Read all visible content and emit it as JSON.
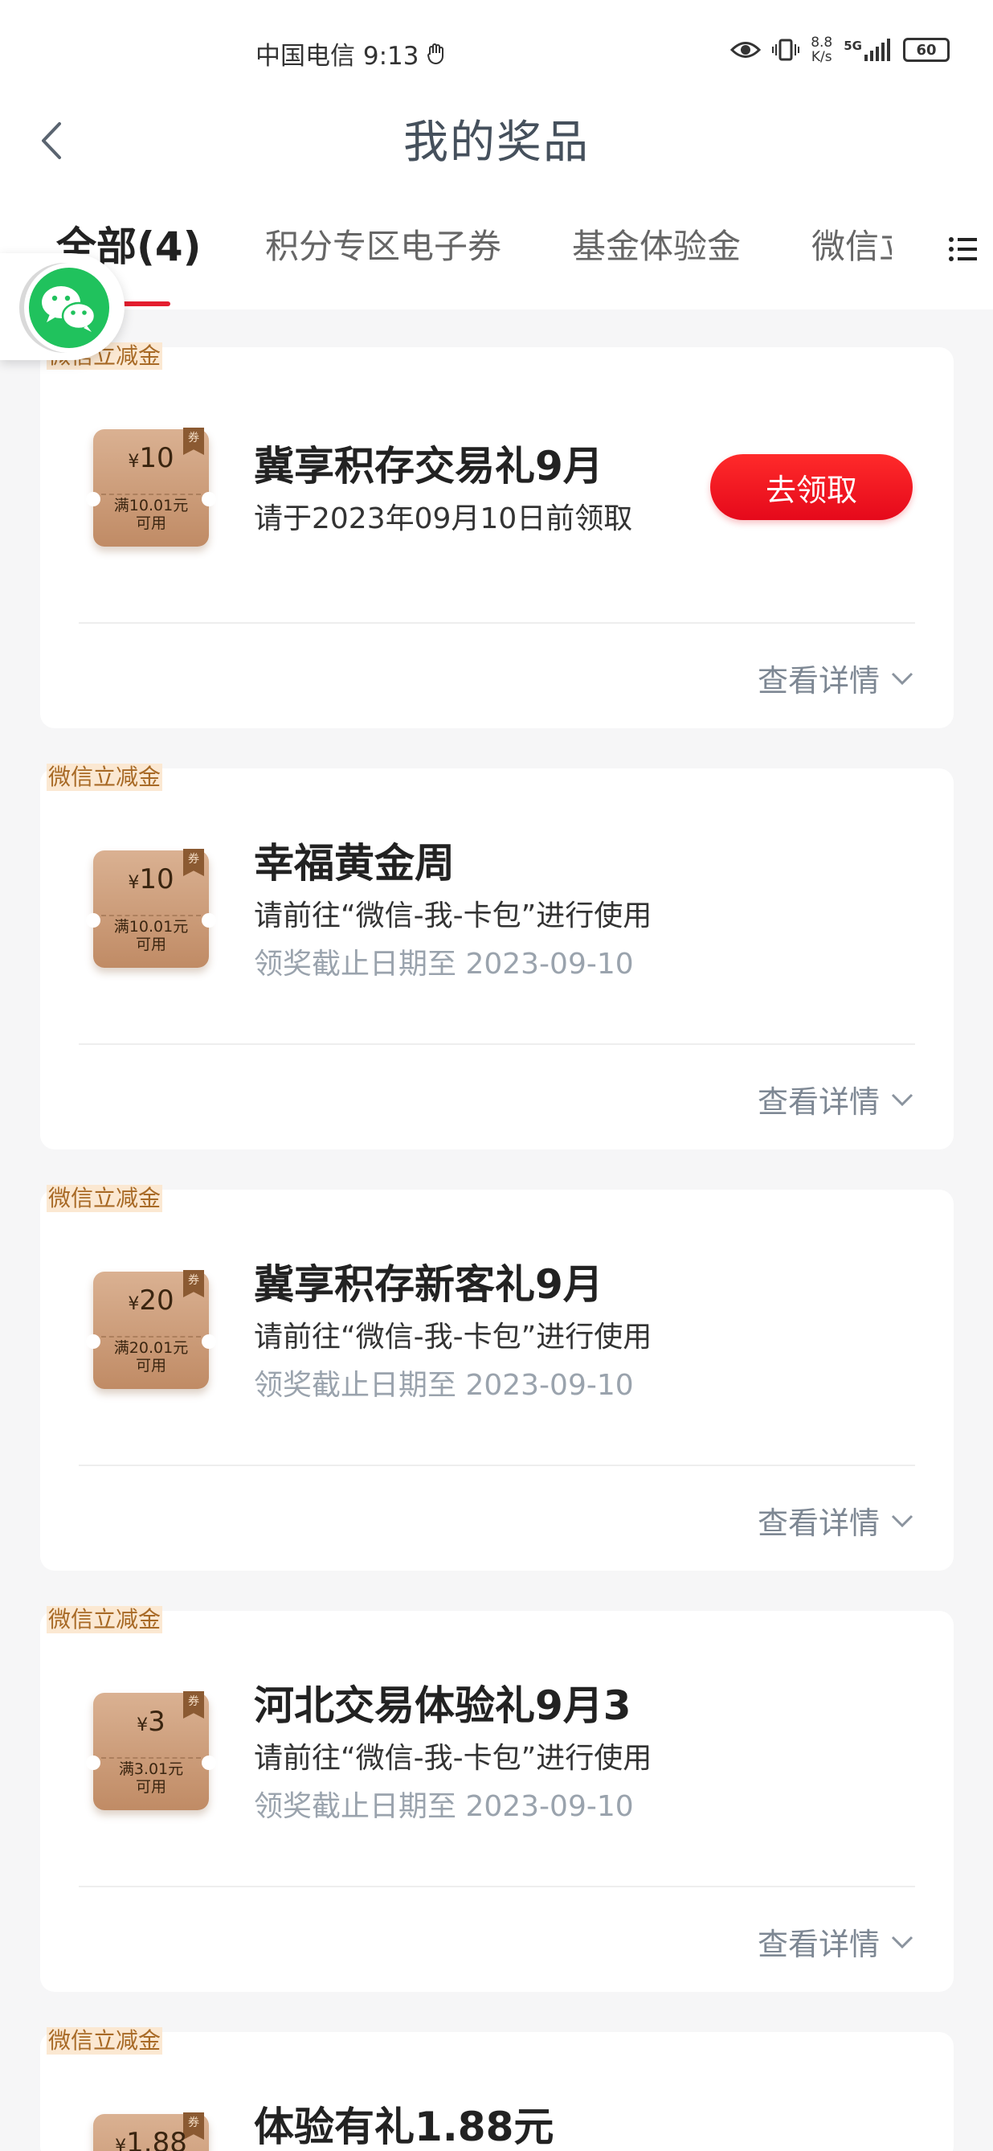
{
  "status_bar": {
    "carrier_time": "中国电信 9:13",
    "speed_top": "8.8",
    "speed_bottom": "K/s",
    "network": "5G",
    "battery": "60"
  },
  "header": {
    "title": "我的奖品"
  },
  "tabs": [
    {
      "label": "全部(4)",
      "active": true
    },
    {
      "label": "积分专区电子券"
    },
    {
      "label": "基金体验金"
    },
    {
      "label": "微信立减金"
    }
  ],
  "cards": [
    {
      "badge": "微信立减金",
      "coupon": {
        "amount": "10",
        "currency": "¥",
        "condition": "满10.01元",
        "usable": "可用",
        "tag": "券"
      },
      "title": "冀享积存交易礼9月",
      "subtitle": "请于2023年09月10日前领取",
      "date": "",
      "button": "去领取",
      "detail": "查看详情"
    },
    {
      "badge": "微信立减金",
      "coupon": {
        "amount": "10",
        "currency": "¥",
        "condition": "满10.01元",
        "usable": "可用",
        "tag": "券"
      },
      "title": "幸福黄金周",
      "subtitle": "请前往“微信-我-卡包”进行使用",
      "date": "领奖截止日期至 2023-09-10",
      "detail": "查看详情"
    },
    {
      "badge": "微信立减金",
      "coupon": {
        "amount": "20",
        "currency": "¥",
        "condition": "满20.01元",
        "usable": "可用",
        "tag": "券"
      },
      "title": "冀享积存新客礼9月",
      "subtitle": "请前往“微信-我-卡包”进行使用",
      "date": "领奖截止日期至 2023-09-10",
      "detail": "查看详情"
    },
    {
      "badge": "微信立减金",
      "coupon": {
        "amount": "3",
        "currency": "¥",
        "condition": "满3.01元",
        "usable": "可用",
        "tag": "券"
      },
      "title": "河北交易体验礼9月3",
      "subtitle": "请前往“微信-我-卡包”进行使用",
      "date": "领奖截止日期至 2023-09-10",
      "detail": "查看详情"
    },
    {
      "badge": "微信立减金",
      "coupon": {
        "amount": "1.88",
        "currency": "¥",
        "condition": "",
        "usable": "",
        "tag": "券"
      },
      "title": "体验有礼1.88元"
    }
  ],
  "colors": {
    "accent_red": "#e41e2f",
    "wechat_green": "#20c25d",
    "badge_text": "#a86a26"
  }
}
